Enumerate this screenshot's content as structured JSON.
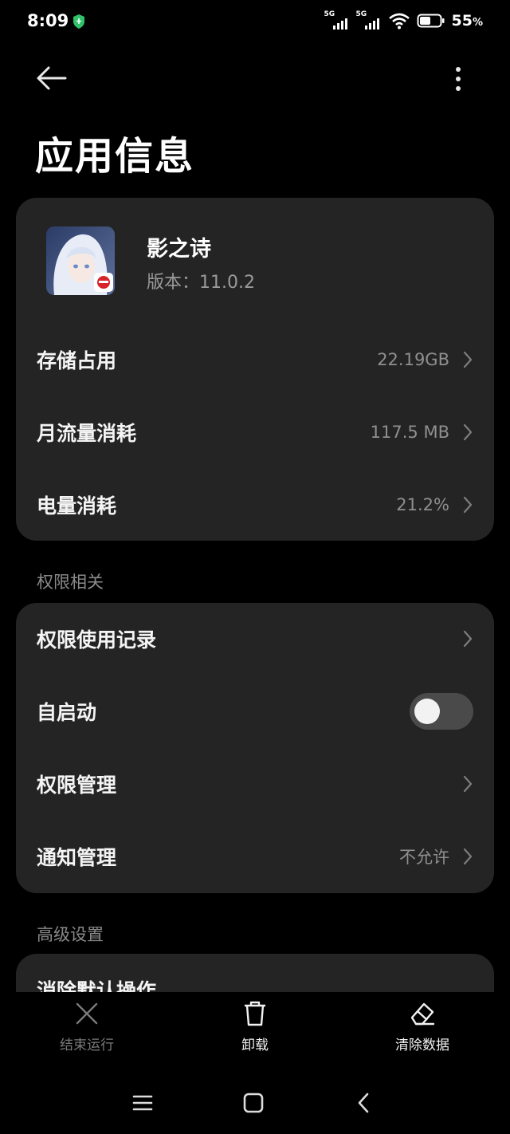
{
  "status_bar": {
    "time": "8:09",
    "network_1": "5G",
    "network_2": "5G",
    "battery_percent": "55",
    "battery_unit": "%"
  },
  "header": {
    "title": "应用信息",
    "back_icon": "back-arrow-icon",
    "more_icon": "more-vertical-icon"
  },
  "app": {
    "name": "影之诗",
    "version": "版本：11.0.2"
  },
  "usage_rows": [
    {
      "label": "存储占用",
      "value": "22.19GB"
    },
    {
      "label": "月流量消耗",
      "value": "117.5 MB"
    },
    {
      "label": "电量消耗",
      "value": "21.2%"
    }
  ],
  "permissions": {
    "section_title": "权限相关",
    "usage_record": "权限使用记录",
    "autostart": "自启动",
    "autostart_enabled": false,
    "permission_management": "权限管理",
    "notification_management": "通知管理",
    "notification_value": "不允许"
  },
  "advanced": {
    "section_title": "高级设置",
    "clear_defaults": "消除默认操作"
  },
  "actions": {
    "stop": "结束运行",
    "uninstall": "卸载",
    "clear_data": "清除数据"
  },
  "colors": {
    "background": "#000000",
    "card": "#242424",
    "secondary_text": "#8f8f8f",
    "toggle_off": "#4a4a4a"
  }
}
